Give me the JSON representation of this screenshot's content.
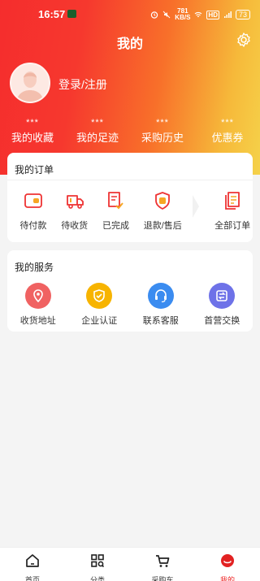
{
  "status": {
    "time": "16:57",
    "speed_top": "781",
    "speed_bottom": "KB/S",
    "battery": "73"
  },
  "header": {
    "title": "我的"
  },
  "user": {
    "login_label": "登录/注册"
  },
  "stats": [
    {
      "value": "***",
      "label": "我的收藏"
    },
    {
      "value": "***",
      "label": "我的足迹"
    },
    {
      "value": "***",
      "label": "采购历史"
    },
    {
      "value": "***",
      "label": "优惠券"
    }
  ],
  "orders": {
    "title": "我的订单",
    "items": [
      {
        "label": "待付款",
        "icon": "wallet-icon"
      },
      {
        "label": "待收货",
        "icon": "truck-icon"
      },
      {
        "label": "已完成",
        "icon": "checklist-icon"
      },
      {
        "label": "退款/售后",
        "icon": "shield-after-sale-icon"
      },
      {
        "label": "全部订单",
        "icon": "all-orders-icon"
      }
    ]
  },
  "services": {
    "title": "我的服务",
    "items": [
      {
        "label": "收货地址",
        "color": "#f06262"
      },
      {
        "label": "企业认证",
        "color": "#f7b400"
      },
      {
        "label": "联系客服",
        "color": "#3b8cf0"
      },
      {
        "label": "首营交换",
        "color": "#6e72e8"
      }
    ]
  },
  "tabbar": {
    "items": [
      {
        "label": "首页"
      },
      {
        "label": "分类"
      },
      {
        "label": "采购车"
      },
      {
        "label": "我的"
      }
    ],
    "active_color": "#e22222"
  }
}
